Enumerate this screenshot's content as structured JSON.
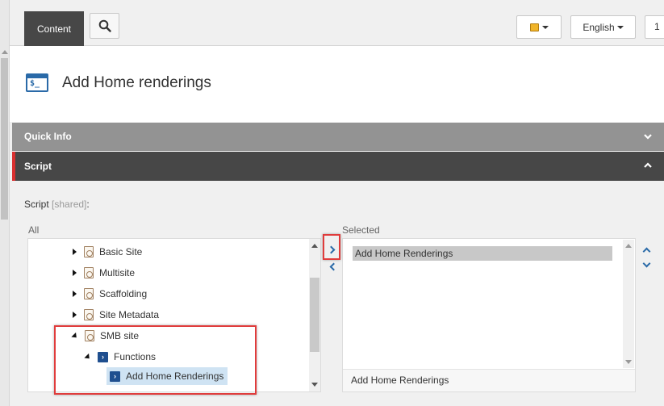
{
  "ribbon": {
    "tab_content": "Content",
    "search_icon": "magnifier-icon",
    "database_icon": "database-icon",
    "language": "English",
    "version_partial": "1"
  },
  "header": {
    "item_icon": "script-console-icon",
    "title": "Add Home renderings"
  },
  "sections": {
    "quick_info": "Quick Info",
    "script": "Script"
  },
  "field": {
    "label": "Script",
    "shared": "[shared]",
    "colon": ":",
    "all_label": "All",
    "selected_label": "Selected"
  },
  "tree": [
    {
      "label": "Basic Site",
      "expanded": false
    },
    {
      "label": "Multisite",
      "expanded": false
    },
    {
      "label": "Scaffolding",
      "expanded": false
    },
    {
      "label": "Site Metadata",
      "expanded": false
    },
    {
      "label": "SMB site",
      "expanded": true
    },
    {
      "label": "Functions",
      "expanded": true
    },
    {
      "label": "Add Home Renderings",
      "selected": true
    }
  ],
  "selected_list": {
    "items": [
      "Add Home Renderings"
    ],
    "footer": "Add Home Renderings"
  },
  "colors": {
    "ribbon_tab": "#474747",
    "quick_info_bar": "#939393",
    "script_bar": "#474747",
    "script_accent": "#d93030",
    "highlight": "#e03c3c",
    "link_blue": "#2a6aa8",
    "tree_selection": "#cfe3f3"
  }
}
